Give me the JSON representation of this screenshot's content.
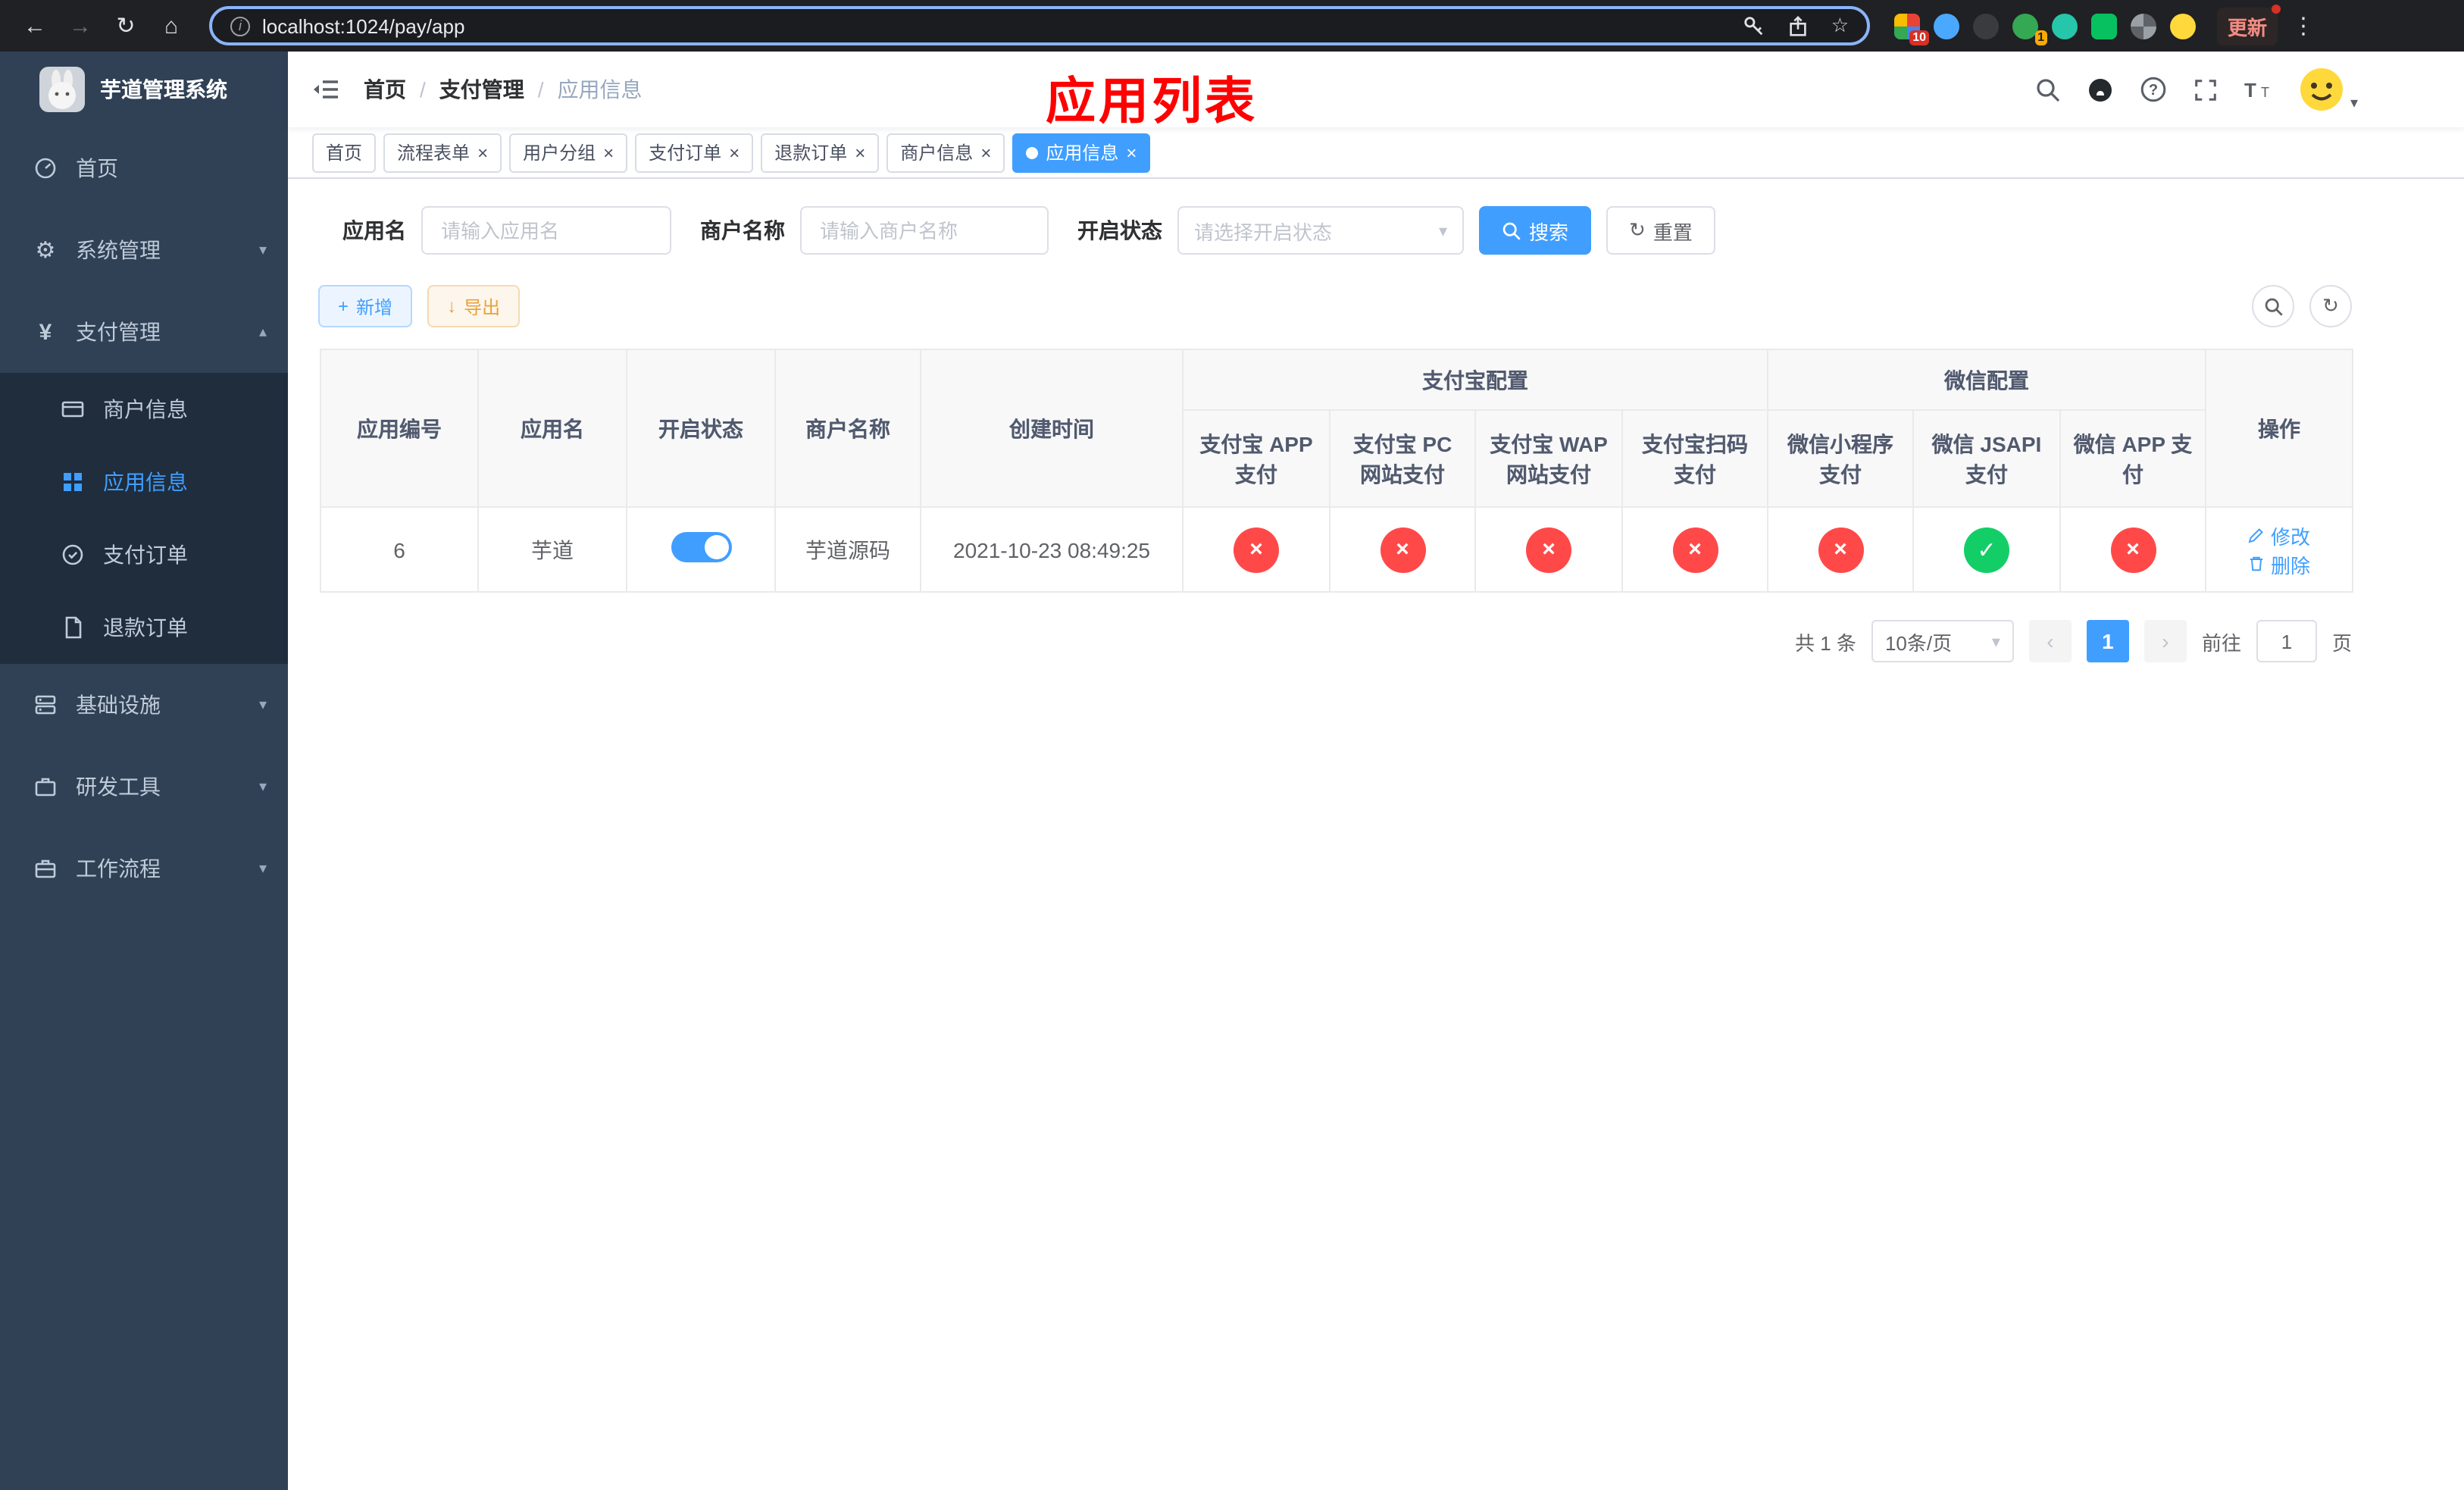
{
  "icons": {
    "back": "←",
    "forward": "→",
    "reload": "↻",
    "home": "⌂",
    "star": "☆",
    "kebab": "⋮",
    "info": "i",
    "close": "×",
    "check": "✓",
    "cross": "×",
    "plus": "+",
    "download": "↓",
    "refresh": "↻",
    "caret_down": "▾",
    "caret_up": "▴",
    "gear": "⚙",
    "yen": "¥",
    "prev": "‹",
    "next": "›"
  },
  "browser": {
    "url": "localhost:1024/pay/app",
    "update_label": "更新",
    "badge_extensions": "10",
    "badge_avatar": "1"
  },
  "sidebar": {
    "title": "芋道管理系统",
    "items": [
      {
        "label": "首页"
      },
      {
        "label": "系统管理"
      },
      {
        "label": "支付管理"
      },
      {
        "label": "基础设施"
      },
      {
        "label": "研发工具"
      },
      {
        "label": "工作流程"
      }
    ],
    "submenu": [
      {
        "label": "商户信息"
      },
      {
        "label": "应用信息"
      },
      {
        "label": "支付订单"
      },
      {
        "label": "退款订单"
      }
    ]
  },
  "header": {
    "annotation": "应用列表",
    "separator": "/",
    "breadcrumb": [
      {
        "label": "首页"
      },
      {
        "label": "支付管理"
      },
      {
        "label": "应用信息"
      }
    ]
  },
  "tabs": [
    {
      "label": "首页"
    },
    {
      "label": "流程表单"
    },
    {
      "label": "用户分组"
    },
    {
      "label": "支付订单"
    },
    {
      "label": "退款订单"
    },
    {
      "label": "商户信息"
    },
    {
      "label": "应用信息"
    }
  ],
  "filters": {
    "app_name_label": "应用名",
    "app_name_placeholder": "请输入应用名",
    "merchant_label": "商户名称",
    "merchant_placeholder": "请输入商户名称",
    "status_label": "开启状态",
    "status_placeholder": "请选择开启状态",
    "search_label": "搜索",
    "reset_label": "重置"
  },
  "toolbar": {
    "add_label": "新增",
    "export_label": "导出"
  },
  "table": {
    "group_alipay": "支付宝配置",
    "group_wechat": "微信配置",
    "columns": [
      "应用编号",
      "应用名",
      "开启状态",
      "商户名称",
      "创建时间",
      "支付宝 APP 支付",
      "支付宝 PC 网站支付",
      "支付宝 WAP 网站支付",
      "支付宝扫码支付",
      "微信小程序支付",
      "微信 JSAPI 支付",
      "微信 APP 支付",
      "操作"
    ],
    "rows": [
      {
        "id": "6",
        "name": "芋道",
        "enabled": true,
        "merchant": "芋道源码",
        "created": "2021-10-23 08:49:25",
        "statuses": {
          "alipay_app": false,
          "alipay_pc": false,
          "alipay_wap": false,
          "alipay_qr": false,
          "wechat_lite": false,
          "wechat_jsapi": true,
          "wechat_app": false
        },
        "edit_label": "修改",
        "delete_label": "删除"
      }
    ]
  },
  "pagination": {
    "total": "共 1 条",
    "page_size": "10条/页",
    "current": "1",
    "goto_label": "前往",
    "goto_value": "1",
    "unit_label": "页"
  },
  "colors": {
    "primary": "#409eff",
    "success": "#13ce66",
    "danger": "#ff4949",
    "warning": "#e6a23c",
    "annotation": "#ff0000"
  }
}
